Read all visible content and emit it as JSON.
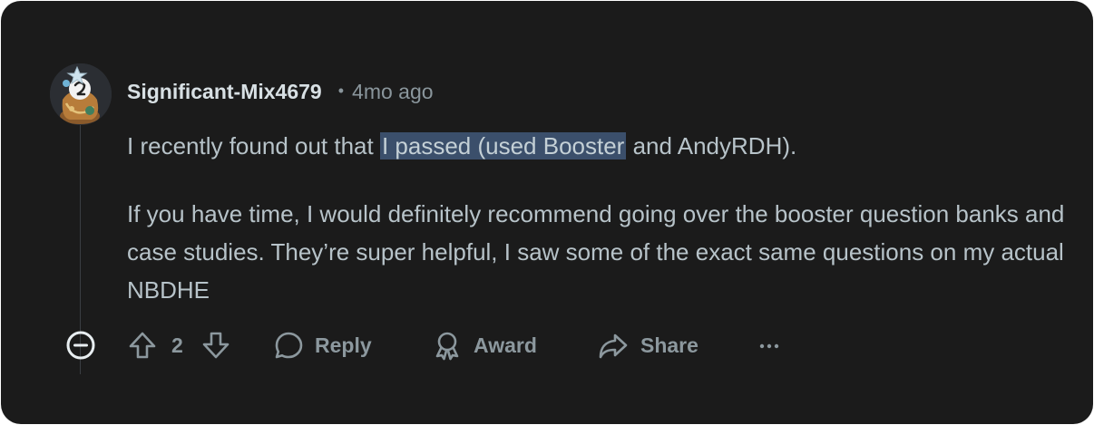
{
  "comment": {
    "username": "Significant-Mix4679",
    "separator": "•",
    "age": "4mo ago",
    "paragraph1": {
      "before": "I recently found out that ",
      "highlighted": "I passed (used Booster",
      "after": " and AndyRDH)."
    },
    "paragraph2": "If you have time, I would definitely recommend going over the booster question banks and case studies. They’re super helpful, I saw some of the exact same questions on my actual NBDHE"
  },
  "actions": {
    "score": "2",
    "reply_label": "Reply",
    "award_label": "Award",
    "share_label": "Share",
    "more_label": "···"
  },
  "colors": {
    "background": "#1b1b1b",
    "text": "#b7c3c9",
    "username": "#d8e0e4",
    "muted": "#8c989e",
    "selection": "#3b4f6b"
  },
  "icons": {
    "collapse": "minus-circle-icon",
    "upvote": "arrow-up-icon",
    "downvote": "arrow-down-icon",
    "reply": "speech-bubble-icon",
    "award": "award-ribbon-icon",
    "share": "share-arrow-icon",
    "more": "more-dots-icon"
  }
}
